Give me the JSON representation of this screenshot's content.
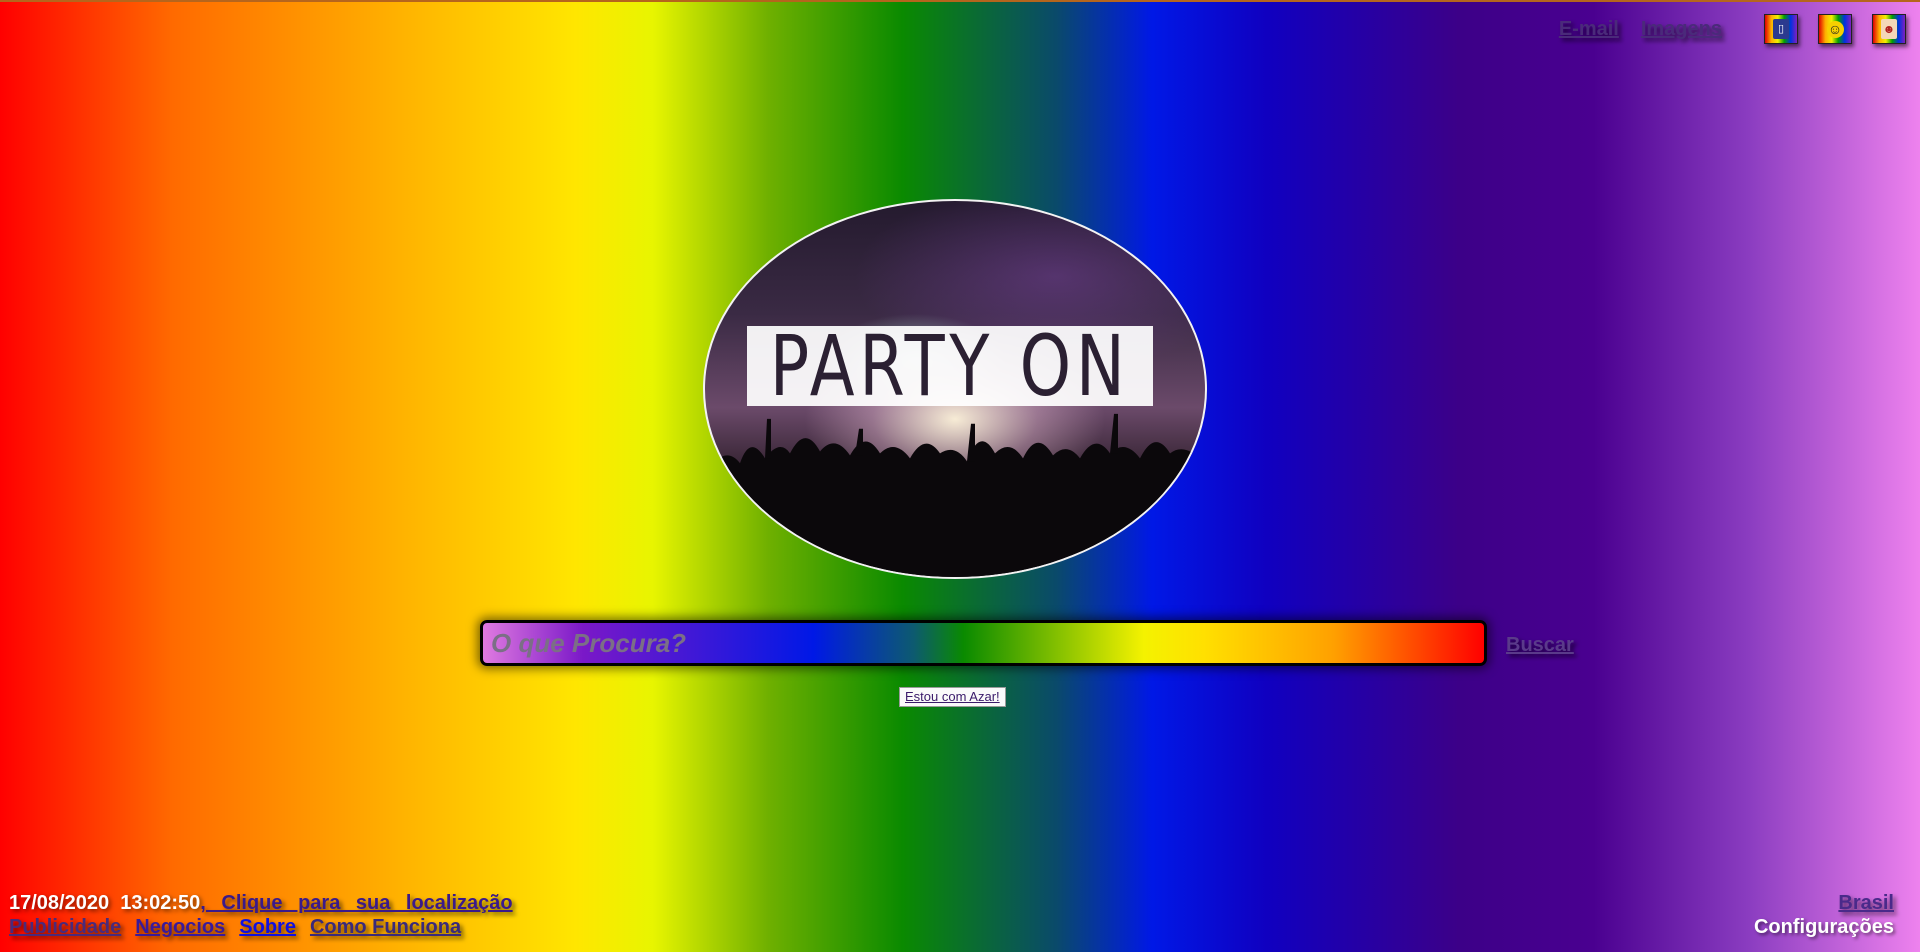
{
  "top_nav": {
    "email_label": "E-mail",
    "images_label": "Imagens",
    "icons": [
      "phone-app-icon",
      "smiley-app-icon",
      "profile-app-icon"
    ]
  },
  "logo": {
    "text": "PARTY ON"
  },
  "search": {
    "placeholder": "O que Procura?",
    "value": "",
    "button_label": "Buscar",
    "lucky_label": "Estou com Azar!"
  },
  "footer": {
    "date": "17/08/2020",
    "time": "13:02:50",
    "location_link": ", Clique para sua localização",
    "links": {
      "advertising": "Publicidade",
      "business": "Negocios",
      "about": "Sobre",
      "how_it_works": "Como Funciona"
    },
    "country": "Brasil",
    "settings": "Configurações"
  },
  "colors": {
    "background_gradient": [
      "#ff0000",
      "#ffb300",
      "#ffe600",
      "#0a8a00",
      "#0018e6",
      "#4a0090",
      "#ee82ee"
    ],
    "link": "#3a1a8a",
    "white_text": "#ffffff"
  }
}
